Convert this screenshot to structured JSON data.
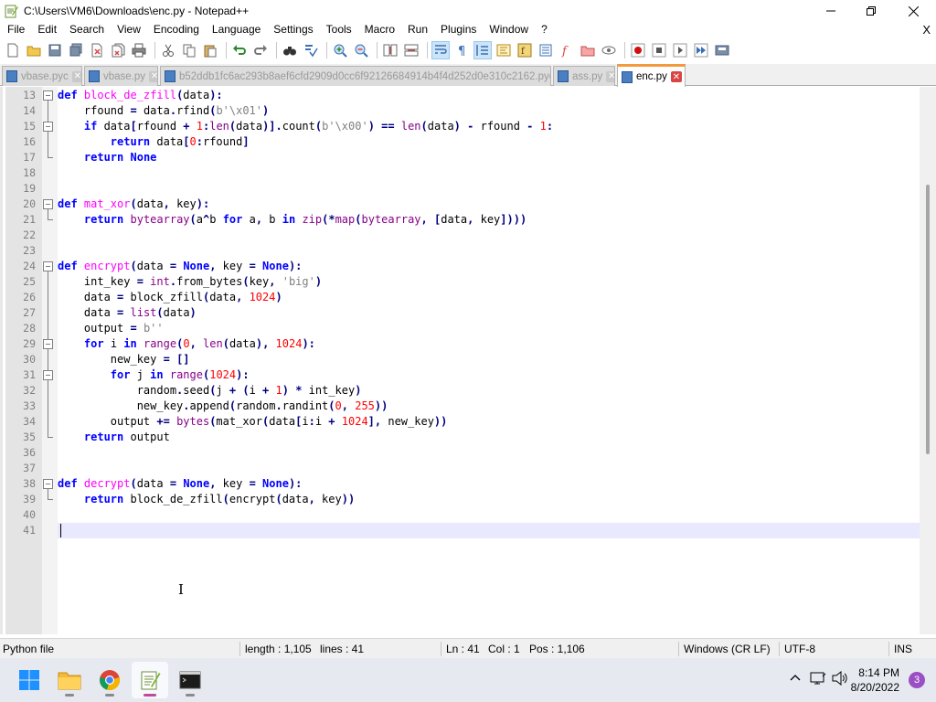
{
  "window": {
    "title": "C:\\Users\\VM6\\Downloads\\enc.py - Notepad++",
    "minimize_label": "—",
    "maximize_label": "❐",
    "close_label": "✕"
  },
  "menu": {
    "items": [
      "File",
      "Edit",
      "Search",
      "View",
      "Encoding",
      "Language",
      "Settings",
      "Tools",
      "Macro",
      "Run",
      "Plugins",
      "Window",
      "?"
    ],
    "doc_close": "X"
  },
  "tabs": [
    {
      "label": "vbase.pyc",
      "active": false
    },
    {
      "label": "vbase.py",
      "active": false
    },
    {
      "label": "b52ddb1fc6ac293b8aef6cfd2909d0cc6f92126684914b4f4d252d0e310c2162.pyc",
      "active": false
    },
    {
      "label": "ass.py",
      "active": false
    },
    {
      "label": "enc.py",
      "active": true
    }
  ],
  "editor": {
    "lines": [
      {
        "num": "13",
        "tokens": [
          [
            "kw",
            "def "
          ],
          [
            "fn",
            "block_de_zfill"
          ],
          [
            "op",
            "("
          ],
          [
            "nm",
            "data"
          ],
          [
            "op",
            "):"
          ]
        ]
      },
      {
        "num": "14",
        "tokens": [
          [
            "nm",
            "    rfound "
          ],
          [
            "op",
            "="
          ],
          [
            "nm",
            " data"
          ],
          [
            "op",
            "."
          ],
          [
            "nm",
            "rfind"
          ],
          [
            "op",
            "("
          ],
          [
            "str",
            "b'\\x01'"
          ],
          [
            "op",
            ")"
          ]
        ]
      },
      {
        "num": "15",
        "tokens": [
          [
            "nm",
            "    "
          ],
          [
            "kw",
            "if"
          ],
          [
            "nm",
            " data"
          ],
          [
            "op",
            "["
          ],
          [
            "nm",
            "rfound "
          ],
          [
            "op",
            "+"
          ],
          [
            "nm",
            " "
          ],
          [
            "num",
            "1"
          ],
          [
            "op",
            ":"
          ],
          [
            "bi",
            "len"
          ],
          [
            "op",
            "("
          ],
          [
            "nm",
            "data"
          ],
          [
            "op",
            ")]."
          ],
          [
            "nm",
            "count"
          ],
          [
            "op",
            "("
          ],
          [
            "str",
            "b'\\x00'"
          ],
          [
            "op",
            ")"
          ],
          [
            "nm",
            " "
          ],
          [
            "op",
            "=="
          ],
          [
            "nm",
            " "
          ],
          [
            "bi",
            "len"
          ],
          [
            "op",
            "("
          ],
          [
            "nm",
            "data"
          ],
          [
            "op",
            ")"
          ],
          [
            "nm",
            " "
          ],
          [
            "op",
            "-"
          ],
          [
            "nm",
            " rfound "
          ],
          [
            "op",
            "-"
          ],
          [
            "nm",
            " "
          ],
          [
            "num",
            "1"
          ],
          [
            "op",
            ":"
          ]
        ]
      },
      {
        "num": "16",
        "tokens": [
          [
            "nm",
            "        "
          ],
          [
            "kw",
            "return"
          ],
          [
            "nm",
            " data"
          ],
          [
            "op",
            "["
          ],
          [
            "num",
            "0"
          ],
          [
            "op",
            ":"
          ],
          [
            "nm",
            "rfound"
          ],
          [
            "op",
            "]"
          ]
        ]
      },
      {
        "num": "17",
        "tokens": [
          [
            "nm",
            "    "
          ],
          [
            "kw",
            "return"
          ],
          [
            "nm",
            " "
          ],
          [
            "kw",
            "None"
          ]
        ]
      },
      {
        "num": "18",
        "tokens": []
      },
      {
        "num": "19",
        "tokens": []
      },
      {
        "num": "20",
        "tokens": [
          [
            "kw",
            "def "
          ],
          [
            "fn",
            "mat_xor"
          ],
          [
            "op",
            "("
          ],
          [
            "nm",
            "data"
          ],
          [
            "op",
            ","
          ],
          [
            "nm",
            " key"
          ],
          [
            "op",
            "):"
          ]
        ]
      },
      {
        "num": "21",
        "tokens": [
          [
            "nm",
            "    "
          ],
          [
            "kw",
            "return"
          ],
          [
            "nm",
            " "
          ],
          [
            "bi",
            "bytearray"
          ],
          [
            "op",
            "("
          ],
          [
            "nm",
            "a"
          ],
          [
            "op",
            "^"
          ],
          [
            "nm",
            "b "
          ],
          [
            "kw",
            "for"
          ],
          [
            "nm",
            " a"
          ],
          [
            "op",
            ","
          ],
          [
            "nm",
            " b "
          ],
          [
            "kw",
            "in"
          ],
          [
            "nm",
            " "
          ],
          [
            "bi",
            "zip"
          ],
          [
            "op",
            "(*"
          ],
          [
            "bi",
            "map"
          ],
          [
            "op",
            "("
          ],
          [
            "bi",
            "bytearray"
          ],
          [
            "op",
            ","
          ],
          [
            "nm",
            " "
          ],
          [
            "op",
            "["
          ],
          [
            "nm",
            "data"
          ],
          [
            "op",
            ","
          ],
          [
            "nm",
            " key"
          ],
          [
            "op",
            "])))"
          ]
        ]
      },
      {
        "num": "22",
        "tokens": []
      },
      {
        "num": "23",
        "tokens": []
      },
      {
        "num": "24",
        "tokens": [
          [
            "kw",
            "def "
          ],
          [
            "fn",
            "encrypt"
          ],
          [
            "op",
            "("
          ],
          [
            "nm",
            "data "
          ],
          [
            "op",
            "="
          ],
          [
            "nm",
            " "
          ],
          [
            "kw",
            "None"
          ],
          [
            "op",
            ","
          ],
          [
            "nm",
            " key "
          ],
          [
            "op",
            "="
          ],
          [
            "nm",
            " "
          ],
          [
            "kw",
            "None"
          ],
          [
            "op",
            "):"
          ]
        ]
      },
      {
        "num": "25",
        "tokens": [
          [
            "nm",
            "    int_key "
          ],
          [
            "op",
            "="
          ],
          [
            "nm",
            " "
          ],
          [
            "bi",
            "int"
          ],
          [
            "op",
            "."
          ],
          [
            "nm",
            "from_bytes"
          ],
          [
            "op",
            "("
          ],
          [
            "nm",
            "key"
          ],
          [
            "op",
            ","
          ],
          [
            "nm",
            " "
          ],
          [
            "str",
            "'big'"
          ],
          [
            "op",
            ")"
          ]
        ]
      },
      {
        "num": "26",
        "tokens": [
          [
            "nm",
            "    data "
          ],
          [
            "op",
            "="
          ],
          [
            "nm",
            " block_zfill"
          ],
          [
            "op",
            "("
          ],
          [
            "nm",
            "data"
          ],
          [
            "op",
            ","
          ],
          [
            "nm",
            " "
          ],
          [
            "num",
            "1024"
          ],
          [
            "op",
            ")"
          ]
        ]
      },
      {
        "num": "27",
        "tokens": [
          [
            "nm",
            "    data "
          ],
          [
            "op",
            "="
          ],
          [
            "nm",
            " "
          ],
          [
            "bi",
            "list"
          ],
          [
            "op",
            "("
          ],
          [
            "nm",
            "data"
          ],
          [
            "op",
            ")"
          ]
        ]
      },
      {
        "num": "28",
        "tokens": [
          [
            "nm",
            "    output "
          ],
          [
            "op",
            "="
          ],
          [
            "nm",
            " "
          ],
          [
            "str",
            "b''"
          ]
        ]
      },
      {
        "num": "29",
        "tokens": [
          [
            "nm",
            "    "
          ],
          [
            "kw",
            "for"
          ],
          [
            "nm",
            " i "
          ],
          [
            "kw",
            "in"
          ],
          [
            "nm",
            " "
          ],
          [
            "bi",
            "range"
          ],
          [
            "op",
            "("
          ],
          [
            "num",
            "0"
          ],
          [
            "op",
            ","
          ],
          [
            "nm",
            " "
          ],
          [
            "bi",
            "len"
          ],
          [
            "op",
            "("
          ],
          [
            "nm",
            "data"
          ],
          [
            "op",
            "),"
          ],
          [
            "nm",
            " "
          ],
          [
            "num",
            "1024"
          ],
          [
            "op",
            "):"
          ]
        ]
      },
      {
        "num": "30",
        "tokens": [
          [
            "nm",
            "        new_key "
          ],
          [
            "op",
            "="
          ],
          [
            "nm",
            " "
          ],
          [
            "op",
            "[]"
          ]
        ]
      },
      {
        "num": "31",
        "tokens": [
          [
            "nm",
            "        "
          ],
          [
            "kw",
            "for"
          ],
          [
            "nm",
            " j "
          ],
          [
            "kw",
            "in"
          ],
          [
            "nm",
            " "
          ],
          [
            "bi",
            "range"
          ],
          [
            "op",
            "("
          ],
          [
            "num",
            "1024"
          ],
          [
            "op",
            "):"
          ]
        ]
      },
      {
        "num": "32",
        "tokens": [
          [
            "nm",
            "            random"
          ],
          [
            "op",
            "."
          ],
          [
            "nm",
            "seed"
          ],
          [
            "op",
            "("
          ],
          [
            "nm",
            "j "
          ],
          [
            "op",
            "+"
          ],
          [
            "nm",
            " "
          ],
          [
            "op",
            "("
          ],
          [
            "nm",
            "i "
          ],
          [
            "op",
            "+"
          ],
          [
            "nm",
            " "
          ],
          [
            "num",
            "1"
          ],
          [
            "op",
            ")"
          ],
          [
            "nm",
            " "
          ],
          [
            "op",
            "*"
          ],
          [
            "nm",
            " int_key"
          ],
          [
            "op",
            ")"
          ]
        ]
      },
      {
        "num": "33",
        "tokens": [
          [
            "nm",
            "            new_key"
          ],
          [
            "op",
            "."
          ],
          [
            "nm",
            "append"
          ],
          [
            "op",
            "("
          ],
          [
            "nm",
            "random"
          ],
          [
            "op",
            "."
          ],
          [
            "nm",
            "randint"
          ],
          [
            "op",
            "("
          ],
          [
            "num",
            "0"
          ],
          [
            "op",
            ","
          ],
          [
            "nm",
            " "
          ],
          [
            "num",
            "255"
          ],
          [
            "op",
            "))"
          ]
        ]
      },
      {
        "num": "34",
        "tokens": [
          [
            "nm",
            "        output "
          ],
          [
            "op",
            "+="
          ],
          [
            "nm",
            " "
          ],
          [
            "bi",
            "bytes"
          ],
          [
            "op",
            "("
          ],
          [
            "nm",
            "mat_xor"
          ],
          [
            "op",
            "("
          ],
          [
            "nm",
            "data"
          ],
          [
            "op",
            "["
          ],
          [
            "nm",
            "i"
          ],
          [
            "op",
            ":"
          ],
          [
            "nm",
            "i "
          ],
          [
            "op",
            "+"
          ],
          [
            "nm",
            " "
          ],
          [
            "num",
            "1024"
          ],
          [
            "op",
            "],"
          ],
          [
            "nm",
            " new_key"
          ],
          [
            "op",
            "))"
          ]
        ]
      },
      {
        "num": "35",
        "tokens": [
          [
            "nm",
            "    "
          ],
          [
            "kw",
            "return"
          ],
          [
            "nm",
            " output"
          ]
        ]
      },
      {
        "num": "36",
        "tokens": []
      },
      {
        "num": "37",
        "tokens": []
      },
      {
        "num": "38",
        "tokens": [
          [
            "kw",
            "def "
          ],
          [
            "fn",
            "decrypt"
          ],
          [
            "op",
            "("
          ],
          [
            "nm",
            "data "
          ],
          [
            "op",
            "="
          ],
          [
            "nm",
            " "
          ],
          [
            "kw",
            "None"
          ],
          [
            "op",
            ","
          ],
          [
            "nm",
            " key "
          ],
          [
            "op",
            "="
          ],
          [
            "nm",
            " "
          ],
          [
            "kw",
            "None"
          ],
          [
            "op",
            "):"
          ]
        ]
      },
      {
        "num": "39",
        "tokens": [
          [
            "nm",
            "    "
          ],
          [
            "kw",
            "return"
          ],
          [
            "nm",
            " block_de_zfill"
          ],
          [
            "op",
            "("
          ],
          [
            "nm",
            "encrypt"
          ],
          [
            "op",
            "("
          ],
          [
            "nm",
            "data"
          ],
          [
            "op",
            ","
          ],
          [
            "nm",
            " key"
          ],
          [
            "op",
            "))"
          ]
        ]
      },
      {
        "num": "40",
        "tokens": []
      },
      {
        "num": "41",
        "tokens": [],
        "current": true
      }
    ]
  },
  "status": {
    "file_type": "Python file",
    "length": "length : 1,105",
    "lines": "lines : 41",
    "ln": "Ln : 41",
    "col": "Col : 1",
    "pos": "Pos : 1,106",
    "eol": "Windows (CR LF)",
    "encoding": "UTF-8",
    "mode": "INS"
  },
  "taskbar": {
    "time": "8:14 PM",
    "date": "8/20/2022",
    "notification_count": "3"
  }
}
